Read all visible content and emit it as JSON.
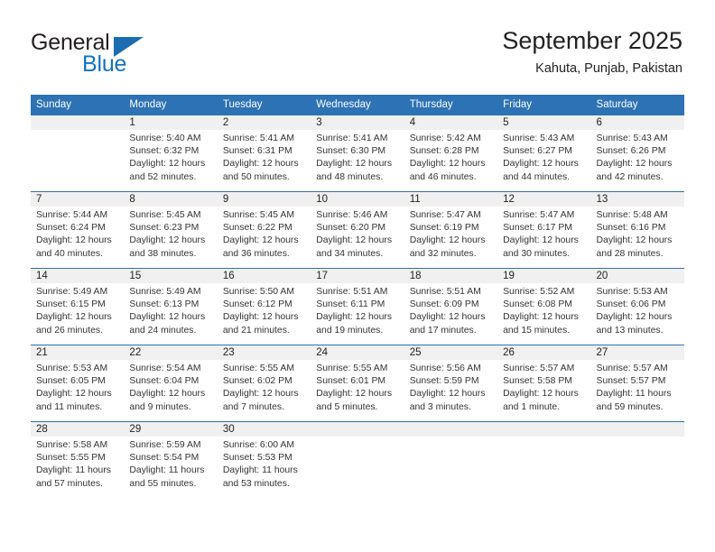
{
  "brand": {
    "word_one": "General",
    "word_two": "Blue",
    "icon": "triangle-logo-icon"
  },
  "header": {
    "title": "September 2025",
    "subtitle": "Kahuta, Punjab, Pakistan"
  },
  "calendar": {
    "accent_color": "#2d72b5",
    "daynum_bg": "#f0f0f0",
    "weekday_headers": [
      "Sunday",
      "Monday",
      "Tuesday",
      "Wednesday",
      "Thursday",
      "Friday",
      "Saturday"
    ],
    "weeks": [
      [
        {
          "day": "",
          "lines": []
        },
        {
          "day": "1",
          "lines": [
            "Sunrise: 5:40 AM",
            "Sunset: 6:32 PM",
            "Daylight: 12 hours",
            "and 52 minutes."
          ]
        },
        {
          "day": "2",
          "lines": [
            "Sunrise: 5:41 AM",
            "Sunset: 6:31 PM",
            "Daylight: 12 hours",
            "and 50 minutes."
          ]
        },
        {
          "day": "3",
          "lines": [
            "Sunrise: 5:41 AM",
            "Sunset: 6:30 PM",
            "Daylight: 12 hours",
            "and 48 minutes."
          ]
        },
        {
          "day": "4",
          "lines": [
            "Sunrise: 5:42 AM",
            "Sunset: 6:28 PM",
            "Daylight: 12 hours",
            "and 46 minutes."
          ]
        },
        {
          "day": "5",
          "lines": [
            "Sunrise: 5:43 AM",
            "Sunset: 6:27 PM",
            "Daylight: 12 hours",
            "and 44 minutes."
          ]
        },
        {
          "day": "6",
          "lines": [
            "Sunrise: 5:43 AM",
            "Sunset: 6:26 PM",
            "Daylight: 12 hours",
            "and 42 minutes."
          ]
        }
      ],
      [
        {
          "day": "7",
          "lines": [
            "Sunrise: 5:44 AM",
            "Sunset: 6:24 PM",
            "Daylight: 12 hours",
            "and 40 minutes."
          ]
        },
        {
          "day": "8",
          "lines": [
            "Sunrise: 5:45 AM",
            "Sunset: 6:23 PM",
            "Daylight: 12 hours",
            "and 38 minutes."
          ]
        },
        {
          "day": "9",
          "lines": [
            "Sunrise: 5:45 AM",
            "Sunset: 6:22 PM",
            "Daylight: 12 hours",
            "and 36 minutes."
          ]
        },
        {
          "day": "10",
          "lines": [
            "Sunrise: 5:46 AM",
            "Sunset: 6:20 PM",
            "Daylight: 12 hours",
            "and 34 minutes."
          ]
        },
        {
          "day": "11",
          "lines": [
            "Sunrise: 5:47 AM",
            "Sunset: 6:19 PM",
            "Daylight: 12 hours",
            "and 32 minutes."
          ]
        },
        {
          "day": "12",
          "lines": [
            "Sunrise: 5:47 AM",
            "Sunset: 6:17 PM",
            "Daylight: 12 hours",
            "and 30 minutes."
          ]
        },
        {
          "day": "13",
          "lines": [
            "Sunrise: 5:48 AM",
            "Sunset: 6:16 PM",
            "Daylight: 12 hours",
            "and 28 minutes."
          ]
        }
      ],
      [
        {
          "day": "14",
          "lines": [
            "Sunrise: 5:49 AM",
            "Sunset: 6:15 PM",
            "Daylight: 12 hours",
            "and 26 minutes."
          ]
        },
        {
          "day": "15",
          "lines": [
            "Sunrise: 5:49 AM",
            "Sunset: 6:13 PM",
            "Daylight: 12 hours",
            "and 24 minutes."
          ]
        },
        {
          "day": "16",
          "lines": [
            "Sunrise: 5:50 AM",
            "Sunset: 6:12 PM",
            "Daylight: 12 hours",
            "and 21 minutes."
          ]
        },
        {
          "day": "17",
          "lines": [
            "Sunrise: 5:51 AM",
            "Sunset: 6:11 PM",
            "Daylight: 12 hours",
            "and 19 minutes."
          ]
        },
        {
          "day": "18",
          "lines": [
            "Sunrise: 5:51 AM",
            "Sunset: 6:09 PM",
            "Daylight: 12 hours",
            "and 17 minutes."
          ]
        },
        {
          "day": "19",
          "lines": [
            "Sunrise: 5:52 AM",
            "Sunset: 6:08 PM",
            "Daylight: 12 hours",
            "and 15 minutes."
          ]
        },
        {
          "day": "20",
          "lines": [
            "Sunrise: 5:53 AM",
            "Sunset: 6:06 PM",
            "Daylight: 12 hours",
            "and 13 minutes."
          ]
        }
      ],
      [
        {
          "day": "21",
          "lines": [
            "Sunrise: 5:53 AM",
            "Sunset: 6:05 PM",
            "Daylight: 12 hours",
            "and 11 minutes."
          ]
        },
        {
          "day": "22",
          "lines": [
            "Sunrise: 5:54 AM",
            "Sunset: 6:04 PM",
            "Daylight: 12 hours",
            "and 9 minutes."
          ]
        },
        {
          "day": "23",
          "lines": [
            "Sunrise: 5:55 AM",
            "Sunset: 6:02 PM",
            "Daylight: 12 hours",
            "and 7 minutes."
          ]
        },
        {
          "day": "24",
          "lines": [
            "Sunrise: 5:55 AM",
            "Sunset: 6:01 PM",
            "Daylight: 12 hours",
            "and 5 minutes."
          ]
        },
        {
          "day": "25",
          "lines": [
            "Sunrise: 5:56 AM",
            "Sunset: 5:59 PM",
            "Daylight: 12 hours",
            "and 3 minutes."
          ]
        },
        {
          "day": "26",
          "lines": [
            "Sunrise: 5:57 AM",
            "Sunset: 5:58 PM",
            "Daylight: 12 hours",
            "and 1 minute."
          ]
        },
        {
          "day": "27",
          "lines": [
            "Sunrise: 5:57 AM",
            "Sunset: 5:57 PM",
            "Daylight: 11 hours",
            "and 59 minutes."
          ]
        }
      ],
      [
        {
          "day": "28",
          "lines": [
            "Sunrise: 5:58 AM",
            "Sunset: 5:55 PM",
            "Daylight: 11 hours",
            "and 57 minutes."
          ]
        },
        {
          "day": "29",
          "lines": [
            "Sunrise: 5:59 AM",
            "Sunset: 5:54 PM",
            "Daylight: 11 hours",
            "and 55 minutes."
          ]
        },
        {
          "day": "30",
          "lines": [
            "Sunrise: 6:00 AM",
            "Sunset: 5:53 PM",
            "Daylight: 11 hours",
            "and 53 minutes."
          ]
        },
        {
          "day": "",
          "lines": []
        },
        {
          "day": "",
          "lines": []
        },
        {
          "day": "",
          "lines": []
        },
        {
          "day": "",
          "lines": []
        }
      ]
    ]
  }
}
